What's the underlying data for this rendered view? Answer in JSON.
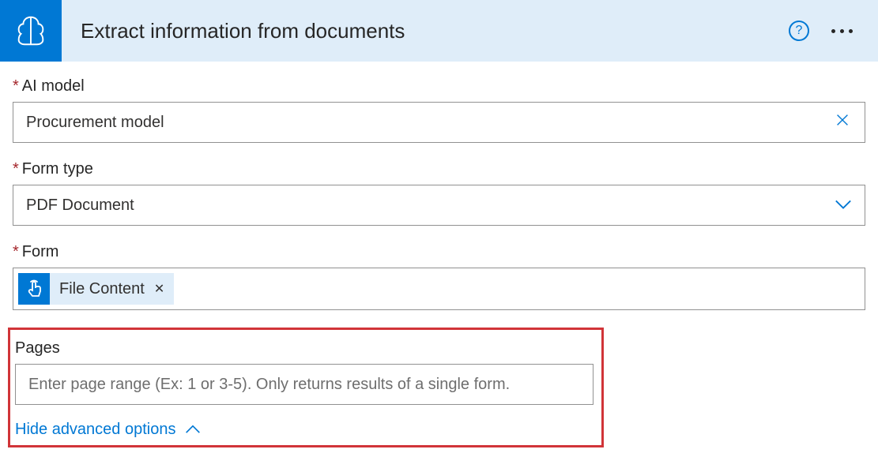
{
  "header": {
    "title": "Extract information from documents"
  },
  "fields": {
    "ai_model": {
      "label": "AI model",
      "value": "Procurement model"
    },
    "form_type": {
      "label": "Form type",
      "value": "PDF Document"
    },
    "form": {
      "label": "Form",
      "token": "File Content"
    },
    "pages": {
      "label": "Pages",
      "placeholder": "Enter page range (Ex: 1 or 3-5). Only returns results of a single form."
    }
  },
  "toggle": {
    "label": "Hide advanced options"
  }
}
